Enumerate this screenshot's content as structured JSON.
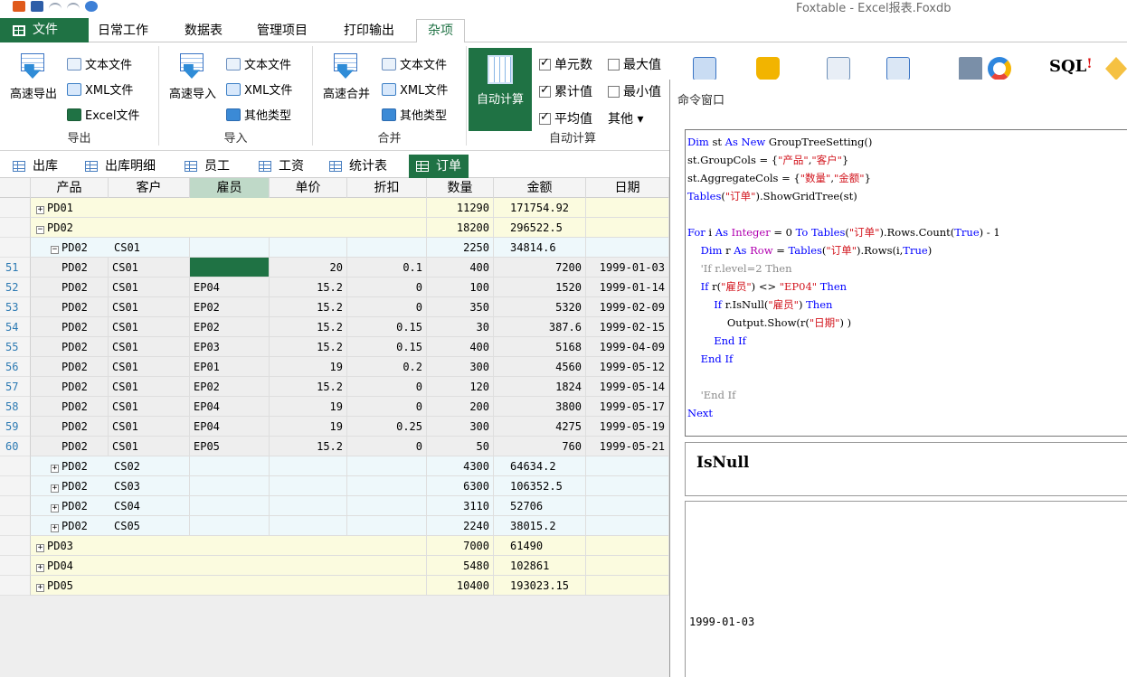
{
  "window": {
    "title": "Foxtable - Excel报表.Foxdb"
  },
  "ribbon_tabs": [
    "文件",
    "日常工作",
    "数据表",
    "管理项目",
    "打印输出",
    "杂项"
  ],
  "ribbon": {
    "export": {
      "big": "高速导出",
      "text": "文本文件",
      "xml": "XML文件",
      "excel": "Excel文件",
      "label": "导出"
    },
    "import": {
      "big": "高速导入",
      "text": "文本文件",
      "xml": "XML文件",
      "other": "其他类型",
      "label": "导入"
    },
    "merge": {
      "big": "高速合并",
      "text": "文本文件",
      "xml": "XML文件",
      "other": "其他类型",
      "label": "合并"
    },
    "autocalc": {
      "big": "自动计算",
      "count": "单元数",
      "max": "最大值",
      "cumulative": "累计值",
      "min": "最小值",
      "average": "平均值",
      "other": "其他 ▾",
      "label": "自动计算"
    },
    "sql": "SQL"
  },
  "sheet_tabs": [
    "出库",
    "出库明细",
    "员工",
    "工资",
    "统计表",
    "订单"
  ],
  "columns": [
    "产品",
    "客户",
    "雇员",
    "单价",
    "折扣",
    "数量",
    "金额",
    "日期"
  ],
  "rows": [
    {
      "level": 1,
      "group": "PD01",
      "qty": "11290",
      "amount": "171754.92"
    },
    {
      "level": 1,
      "group": "PD02",
      "qty": "18200",
      "amount": "296522.5",
      "expanded": true
    },
    {
      "level": 2,
      "group": "PD02",
      "customer": "CS01",
      "qty": "2250",
      "amount": "34814.6",
      "expanded": true
    },
    {
      "level": 3,
      "num": "51",
      "product": "PD02",
      "customer": "CS01",
      "employee": "",
      "price": "20",
      "discount": "0.1",
      "qty": "400",
      "amount": "7200",
      "date": "1999-01-03",
      "selected": true
    },
    {
      "level": 3,
      "num": "52",
      "product": "PD02",
      "customer": "CS01",
      "employee": "EP04",
      "price": "15.2",
      "discount": "0",
      "qty": "100",
      "amount": "1520",
      "date": "1999-01-14"
    },
    {
      "level": 3,
      "num": "53",
      "product": "PD02",
      "customer": "CS01",
      "employee": "EP02",
      "price": "15.2",
      "discount": "0",
      "qty": "350",
      "amount": "5320",
      "date": "1999-02-09"
    },
    {
      "level": 3,
      "num": "54",
      "product": "PD02",
      "customer": "CS01",
      "employee": "EP02",
      "price": "15.2",
      "discount": "0.15",
      "qty": "30",
      "amount": "387.6",
      "date": "1999-02-15"
    },
    {
      "level": 3,
      "num": "55",
      "product": "PD02",
      "customer": "CS01",
      "employee": "EP03",
      "price": "15.2",
      "discount": "0.15",
      "qty": "400",
      "amount": "5168",
      "date": "1999-04-09"
    },
    {
      "level": 3,
      "num": "56",
      "product": "PD02",
      "customer": "CS01",
      "employee": "EP01",
      "price": "19",
      "discount": "0.2",
      "qty": "300",
      "amount": "4560",
      "date": "1999-05-12"
    },
    {
      "level": 3,
      "num": "57",
      "product": "PD02",
      "customer": "CS01",
      "employee": "EP02",
      "price": "15.2",
      "discount": "0",
      "qty": "120",
      "amount": "1824",
      "date": "1999-05-14"
    },
    {
      "level": 3,
      "num": "58",
      "product": "PD02",
      "customer": "CS01",
      "employee": "EP04",
      "price": "19",
      "discount": "0",
      "qty": "200",
      "amount": "3800",
      "date": "1999-05-17"
    },
    {
      "level": 3,
      "num": "59",
      "product": "PD02",
      "customer": "CS01",
      "employee": "EP04",
      "price": "19",
      "discount": "0.25",
      "qty": "300",
      "amount": "4275",
      "date": "1999-05-19"
    },
    {
      "level": 3,
      "num": "60",
      "product": "PD02",
      "customer": "CS01",
      "employee": "EP05",
      "price": "15.2",
      "discount": "0",
      "qty": "50",
      "amount": "760",
      "date": "1999-05-21"
    },
    {
      "level": 2,
      "group": "PD02",
      "customer": "CS02",
      "qty": "4300",
      "amount": "64634.2"
    },
    {
      "level": 2,
      "group": "PD02",
      "customer": "CS03",
      "qty": "6300",
      "amount": "106352.5"
    },
    {
      "level": 2,
      "group": "PD02",
      "customer": "CS04",
      "qty": "3110",
      "amount": "52706"
    },
    {
      "level": 2,
      "group": "PD02",
      "customer": "CS05",
      "qty": "2240",
      "amount": "38015.2"
    },
    {
      "level": 1,
      "group": "PD03",
      "qty": "7000",
      "amount": "61490"
    },
    {
      "level": 1,
      "group": "PD04",
      "qty": "5480",
      "amount": "102861"
    },
    {
      "level": 1,
      "group": "PD05",
      "qty": "10400",
      "amount": "193023.15"
    }
  ],
  "command_window": {
    "title": "命令窗口",
    "code_lines": [
      [
        [
          "kw",
          "Dim"
        ],
        [
          "t",
          " st "
        ],
        [
          "kw",
          "As New"
        ],
        [
          "t",
          " GroupTreeSetting()"
        ]
      ],
      [
        [
          "t",
          "st.GroupCols = {"
        ],
        [
          "str",
          "\"产品\""
        ],
        [
          "t",
          ","
        ],
        [
          "str",
          "\"客户\""
        ],
        [
          "t",
          "}"
        ]
      ],
      [
        [
          "t",
          "st.AggregateCols = {"
        ],
        [
          "str",
          "\"数量\""
        ],
        [
          "t",
          ","
        ],
        [
          "str",
          "\"金额\""
        ],
        [
          "t",
          "}"
        ]
      ],
      [
        [
          "kw",
          "Tables"
        ],
        [
          "t",
          "("
        ],
        [
          "str",
          "\"订单\""
        ],
        [
          "t",
          ").ShowGridTree(st)"
        ]
      ],
      [
        [
          "t",
          ""
        ]
      ],
      [
        [
          "kw",
          "For"
        ],
        [
          "t",
          " i "
        ],
        [
          "kw",
          "As"
        ],
        [
          "t",
          " "
        ],
        [
          "pr",
          "Integer"
        ],
        [
          "t",
          " = 0 "
        ],
        [
          "kw",
          "To"
        ],
        [
          "t",
          " "
        ],
        [
          "kw",
          "Tables"
        ],
        [
          "t",
          "("
        ],
        [
          "str",
          "\"订单\""
        ],
        [
          "t",
          ").Rows.Count("
        ],
        [
          "kw",
          "True"
        ],
        [
          "t",
          ") - 1"
        ]
      ],
      [
        [
          "t",
          "    "
        ],
        [
          "kw",
          "Dim"
        ],
        [
          "t",
          " r "
        ],
        [
          "kw",
          "As"
        ],
        [
          "t",
          " "
        ],
        [
          "pr",
          "Row"
        ],
        [
          "t",
          " = "
        ],
        [
          "kw",
          "Tables"
        ],
        [
          "t",
          "("
        ],
        [
          "str",
          "\"订单\""
        ],
        [
          "t",
          ").Rows(i,"
        ],
        [
          "kw",
          "True"
        ],
        [
          "t",
          ")"
        ]
      ],
      [
        [
          "t",
          "    "
        ],
        [
          "cm",
          "'If r.level=2 Then"
        ]
      ],
      [
        [
          "t",
          "    "
        ],
        [
          "kw",
          "If"
        ],
        [
          "t",
          " r("
        ],
        [
          "str",
          "\"雇员\""
        ],
        [
          "t",
          ") <> "
        ],
        [
          "str",
          "\"EP04\""
        ],
        [
          "t",
          " "
        ],
        [
          "kw",
          "Then"
        ]
      ],
      [
        [
          "t",
          "        "
        ],
        [
          "kw",
          "If"
        ],
        [
          "t",
          " r.IsNull("
        ],
        [
          "str",
          "\"雇员\""
        ],
        [
          "t",
          ") "
        ],
        [
          "kw",
          "Then"
        ]
      ],
      [
        [
          "t",
          "            Output.Show(r("
        ],
        [
          "str",
          "\"日期\""
        ],
        [
          "t",
          ") )"
        ]
      ],
      [
        [
          "t",
          "        "
        ],
        [
          "kw",
          "End If"
        ]
      ],
      [
        [
          "t",
          "    "
        ],
        [
          "kw",
          "End If"
        ]
      ],
      [
        [
          "t",
          ""
        ]
      ],
      [
        [
          "t",
          "    "
        ],
        [
          "cm",
          "'End If"
        ]
      ],
      [
        [
          "kw",
          "Next"
        ]
      ]
    ],
    "help_keyword": "IsNull",
    "output": "1999-01-03"
  }
}
